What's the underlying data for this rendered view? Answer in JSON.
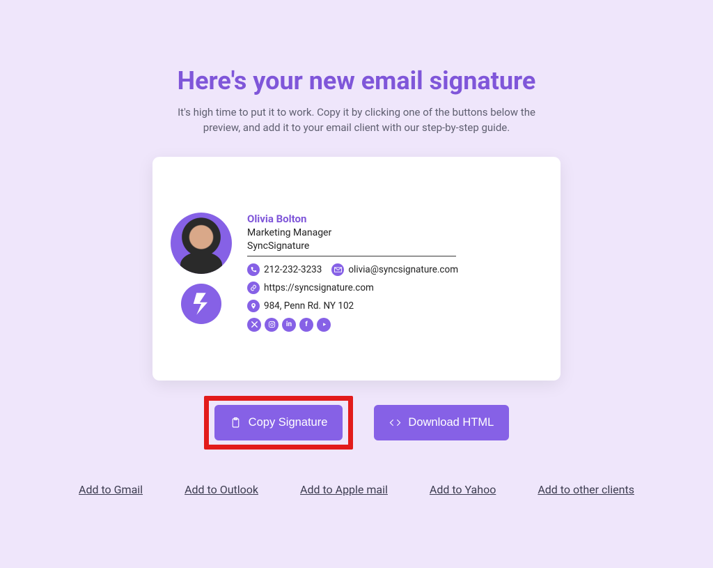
{
  "header": {
    "title": "Here's your new email signature",
    "subtitle": "It's high time to put it to work. Copy it by clicking one of the buttons below the preview, and add it to your email client with our step-by-step guide."
  },
  "signature": {
    "name": "Olivia Bolton",
    "job_title": "Marketing Manager",
    "company": "SyncSignature",
    "phone": "212-232-3233",
    "email": "olivia@syncsignature.com",
    "website": "https://syncsignature.com",
    "address": "984, Penn Rd. NY 102",
    "socials": [
      "x",
      "instagram",
      "linkedin",
      "facebook",
      "youtube"
    ]
  },
  "actions": {
    "copy_label": "Copy Signature",
    "download_label": "Download HTML"
  },
  "links": {
    "gmail": "Add to Gmail",
    "outlook": "Add to Outlook",
    "apple": "Add to Apple mail",
    "yahoo": "Add to Yahoo",
    "other": "Add to other clients"
  },
  "colors": {
    "accent": "#8661e6",
    "background": "#efe6fb"
  }
}
